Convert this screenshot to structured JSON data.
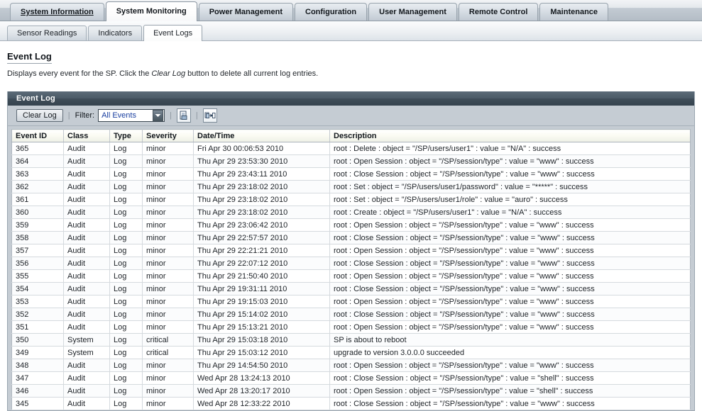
{
  "nav": {
    "tabs": [
      {
        "label": "System Information",
        "active": false,
        "link_style": true
      },
      {
        "label": "System Monitoring",
        "active": true,
        "link_style": false
      },
      {
        "label": "Power Management",
        "active": false,
        "link_style": false
      },
      {
        "label": "Configuration",
        "active": false,
        "link_style": false
      },
      {
        "label": "User Management",
        "active": false,
        "link_style": false
      },
      {
        "label": "Remote Control",
        "active": false,
        "link_style": false
      },
      {
        "label": "Maintenance",
        "active": false,
        "link_style": false
      }
    ]
  },
  "subnav": {
    "tabs": [
      {
        "label": "Sensor Readings",
        "active": false
      },
      {
        "label": "Indicators",
        "active": false
      },
      {
        "label": "Event Logs",
        "active": true
      }
    ]
  },
  "page": {
    "title": "Event Log",
    "description_before": "Displays every event for the SP. Click the ",
    "description_italic": "Clear Log",
    "description_after": " button to delete all current log entries."
  },
  "panel": {
    "header_title": "Event Log",
    "toolbar": {
      "clear_log_label": "Clear Log",
      "filter_label": "Filter:",
      "filter_value": "All Events",
      "filter_options": [
        "All Events"
      ],
      "separator": "|",
      "save_icon_name": "document-save-icon",
      "export_icon_name": "copy-to-file-icon"
    }
  },
  "table": {
    "columns": [
      "Event ID",
      "Class",
      "Type",
      "Severity",
      "Date/Time",
      "Description"
    ],
    "rows": [
      [
        "365",
        "Audit",
        "Log",
        "minor",
        "Fri Apr 30 00:06:53 2010",
        "root : Delete : object = \"/SP/users/user1\" : value = \"N/A\" : success"
      ],
      [
        "364",
        "Audit",
        "Log",
        "minor",
        "Thu Apr 29 23:53:30 2010",
        "root : Open Session : object = \"/SP/session/type\" : value = \"www\" : success"
      ],
      [
        "363",
        "Audit",
        "Log",
        "minor",
        "Thu Apr 29 23:43:11 2010",
        "root : Close Session : object = \"/SP/session/type\" : value = \"www\" : success"
      ],
      [
        "362",
        "Audit",
        "Log",
        "minor",
        "Thu Apr 29 23:18:02 2010",
        "root : Set : object = \"/SP/users/user1/password\" : value = \"*****\" : success"
      ],
      [
        "361",
        "Audit",
        "Log",
        "minor",
        "Thu Apr 29 23:18:02 2010",
        "root : Set : object = \"/SP/users/user1/role\" : value = \"auro\" : success"
      ],
      [
        "360",
        "Audit",
        "Log",
        "minor",
        "Thu Apr 29 23:18:02 2010",
        "root : Create : object = \"/SP/users/user1\" : value = \"N/A\" : success"
      ],
      [
        "359",
        "Audit",
        "Log",
        "minor",
        "Thu Apr 29 23:06:42 2010",
        "root : Open Session : object = \"/SP/session/type\" : value = \"www\" : success"
      ],
      [
        "358",
        "Audit",
        "Log",
        "minor",
        "Thu Apr 29 22:57:57 2010",
        "root : Close Session : object = \"/SP/session/type\" : value = \"www\" : success"
      ],
      [
        "357",
        "Audit",
        "Log",
        "minor",
        "Thu Apr 29 22:21:21 2010",
        "root : Open Session : object = \"/SP/session/type\" : value = \"www\" : success"
      ],
      [
        "356",
        "Audit",
        "Log",
        "minor",
        "Thu Apr 29 22:07:12 2010",
        "root : Close Session : object = \"/SP/session/type\" : value = \"www\" : success"
      ],
      [
        "355",
        "Audit",
        "Log",
        "minor",
        "Thu Apr 29 21:50:40 2010",
        "root : Open Session : object = \"/SP/session/type\" : value = \"www\" : success"
      ],
      [
        "354",
        "Audit",
        "Log",
        "minor",
        "Thu Apr 29 19:31:11 2010",
        "root : Close Session : object = \"/SP/session/type\" : value = \"www\" : success"
      ],
      [
        "353",
        "Audit",
        "Log",
        "minor",
        "Thu Apr 29 19:15:03 2010",
        "root : Open Session : object = \"/SP/session/type\" : value = \"www\" : success"
      ],
      [
        "352",
        "Audit",
        "Log",
        "minor",
        "Thu Apr 29 15:14:02 2010",
        "root : Close Session : object = \"/SP/session/type\" : value = \"www\" : success"
      ],
      [
        "351",
        "Audit",
        "Log",
        "minor",
        "Thu Apr 29 15:13:21 2010",
        "root : Open Session : object = \"/SP/session/type\" : value = \"www\" : success"
      ],
      [
        "350",
        "System",
        "Log",
        "critical",
        "Thu Apr 29 15:03:18 2010",
        "SP is about to reboot"
      ],
      [
        "349",
        "System",
        "Log",
        "critical",
        "Thu Apr 29 15:03:12 2010",
        "upgrade to version 3.0.0.0 succeeded"
      ],
      [
        "348",
        "Audit",
        "Log",
        "minor",
        "Thu Apr 29 14:54:50 2010",
        "root : Open Session : object = \"/SP/session/type\" : value = \"www\" : success"
      ],
      [
        "347",
        "Audit",
        "Log",
        "minor",
        "Wed Apr 28 13:24:13 2010",
        "root : Close Session : object = \"/SP/session/type\" : value = \"shell\" : success"
      ],
      [
        "346",
        "Audit",
        "Log",
        "minor",
        "Wed Apr 28 13:20:17 2010",
        "root : Open Session : object = \"/SP/session/type\" : value = \"shell\" : success"
      ],
      [
        "345",
        "Audit",
        "Log",
        "minor",
        "Wed Apr 28 12:33:22 2010",
        "root : Close Session : object = \"/SP/session/type\" : value = \"www\" : success"
      ]
    ]
  },
  "colors": {
    "panel_header_bg": "#42505c",
    "toolbar_bg": "#c5ccd3",
    "accent_link": "#1a3fa0"
  }
}
